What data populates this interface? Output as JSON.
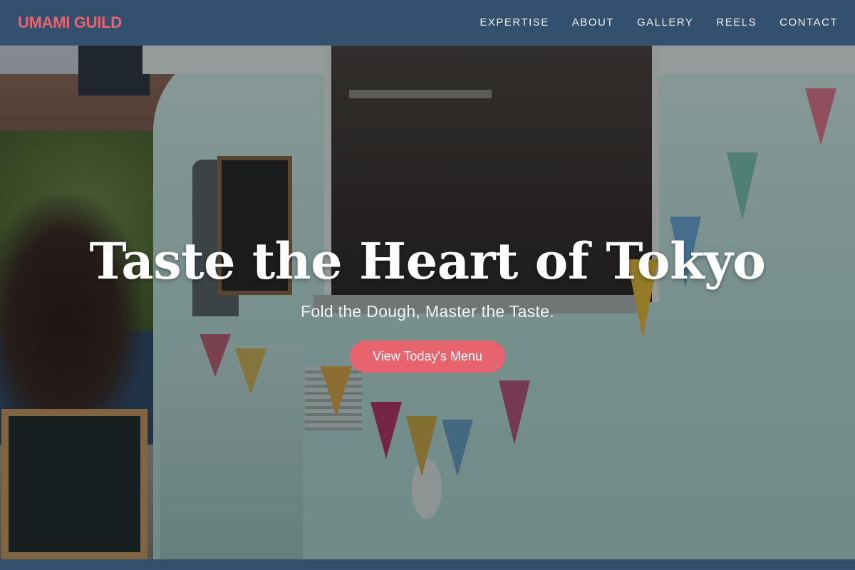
{
  "brand": {
    "name": "UMAMI GUILD",
    "accent_color": "#e7646f",
    "nav_background": "#34506f"
  },
  "nav": {
    "items": [
      {
        "label": "EXPERTISE"
      },
      {
        "label": "ABOUT"
      },
      {
        "label": "GALLERY"
      },
      {
        "label": "REELS"
      },
      {
        "label": "CONTACT"
      }
    ]
  },
  "hero": {
    "title": "Taste the Heart of Tokyo",
    "subtitle": "Fold the Dough, Master the Taste.",
    "cta_label": "View Today's Menu"
  }
}
